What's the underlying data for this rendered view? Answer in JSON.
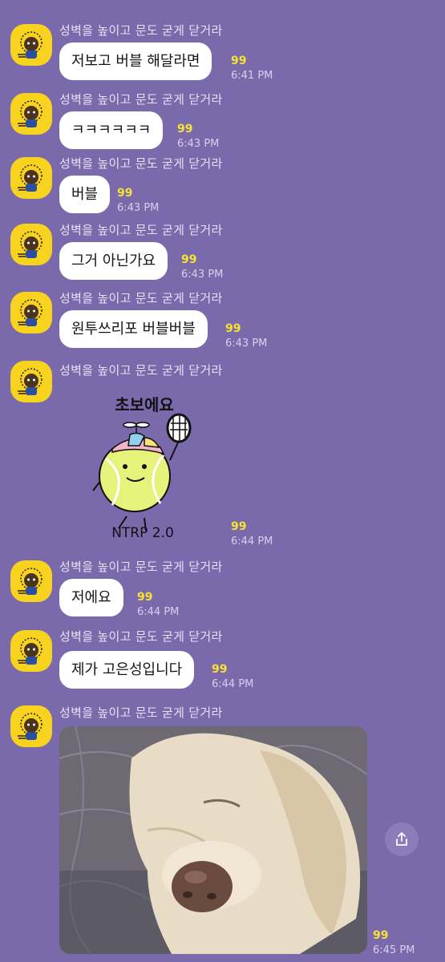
{
  "sender_name": "성벽을 높이고 문도 굳게 닫거라",
  "colors": {
    "background": "#7a6aac",
    "bubble": "#ffffff",
    "unread": "#f7e234",
    "avatar": "#f7d21e"
  },
  "messages": [
    {
      "text": "저보고 버블 해달라면",
      "unread": "99",
      "time": "6:41 PM"
    },
    {
      "text": "ㅋㅋㅋㅋㅋㅋ",
      "unread": "99",
      "time": "6:43 PM"
    },
    {
      "text": "버블",
      "unread": "99",
      "time": "6:43 PM"
    },
    {
      "text": "그거 아닌가요",
      "unread": "99",
      "time": "6:43 PM"
    },
    {
      "text": "원투쓰리포 버블버블",
      "unread": "99",
      "time": "6:43 PM"
    },
    {
      "sticker_top": "초보에요",
      "sticker_bottom": "NTRP 2.0",
      "unread": "99",
      "time": "6:44 PM"
    },
    {
      "text": "저에요",
      "unread": "99",
      "time": "6:44 PM"
    },
    {
      "text": "제가 고은성입니다",
      "unread": "99",
      "time": "6:44 PM"
    },
    {
      "photo_icon": "photo-of-sleeping-dog",
      "unread": "99",
      "time": "6:45 PM"
    }
  ],
  "share_icon": "share-icon"
}
